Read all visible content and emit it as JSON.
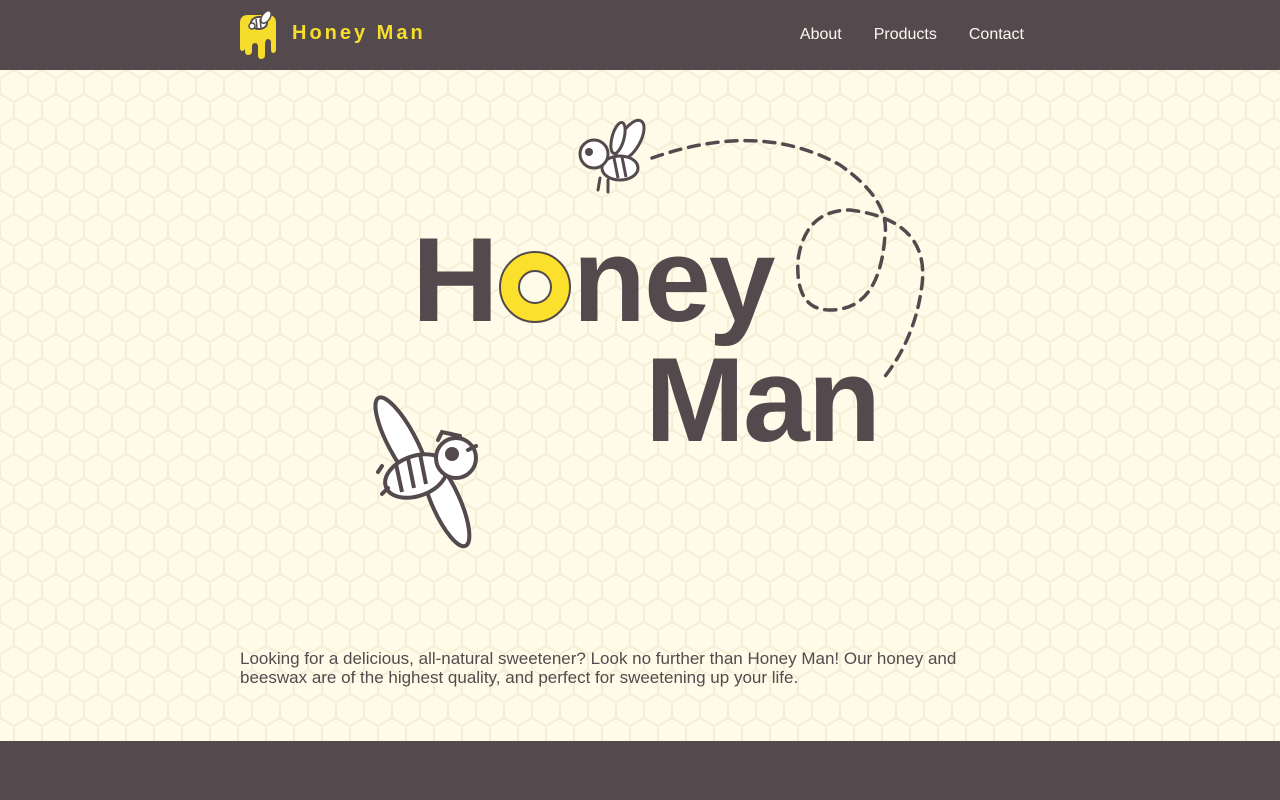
{
  "header": {
    "brand": "Honey Man",
    "nav": [
      "About",
      "Products",
      "Contact"
    ]
  },
  "hero": {
    "title_line1_h": "H",
    "title_line1_rest": "ney",
    "title_line2": "Man",
    "blurb": "Looking for a delicious, all-natural sweetener? Look no further than Honey Man! Our honey and beeswax are of the highest quality, and perfect for sweetening up your life."
  },
  "colors": {
    "header_bg": "#544a4d",
    "accent_yellow": "#fbe12b",
    "hero_bg": "#fefce9",
    "text_dark": "#544a4d"
  },
  "icons": [
    "honey-bee-logo-icon",
    "bee-small-icon",
    "bee-large-icon",
    "dashed-flight-path"
  ]
}
